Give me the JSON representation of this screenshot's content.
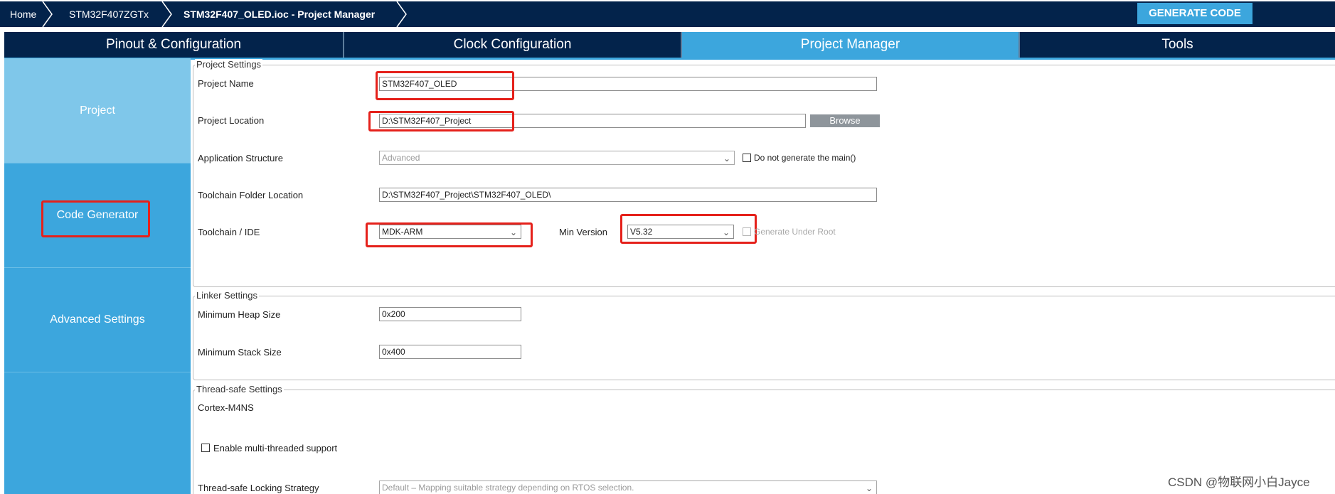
{
  "breadcrumb": {
    "home": "Home",
    "device": "STM32F407ZGTx",
    "project": "STM32F407_OLED.ioc - Project Manager"
  },
  "generate_button": "GENERATE CODE",
  "tabs": [
    {
      "label": "Pinout & Configuration",
      "active": false
    },
    {
      "label": "Clock Configuration",
      "active": false
    },
    {
      "label": "Project Manager",
      "active": true
    },
    {
      "label": "Tools",
      "active": false
    }
  ],
  "sidebar": {
    "items": [
      {
        "label": "Project",
        "active": true
      },
      {
        "label": "Code Generator",
        "active": false
      },
      {
        "label": "Advanced Settings",
        "active": false
      }
    ]
  },
  "project_settings": {
    "legend": "Project Settings",
    "project_name_label": "Project Name",
    "project_name_value": "STM32F407_OLED",
    "project_location_label": "Project Location",
    "project_location_value": "D:\\STM32F407_Project",
    "browse_label": "Browse",
    "app_structure_label": "Application Structure",
    "app_structure_value": "Advanced",
    "do_not_generate_main_label": "Do not generate the main()",
    "toolchain_folder_label": "Toolchain Folder Location",
    "toolchain_folder_value": "D:\\STM32F407_Project\\STM32F407_OLED\\",
    "toolchain_ide_label": "Toolchain / IDE",
    "toolchain_ide_value": "MDK-ARM",
    "min_version_label": "Min Version",
    "min_version_value": "V5.32",
    "generate_under_root_label": "Generate Under Root"
  },
  "linker_settings": {
    "legend": "Linker Settings",
    "heap_label": "Minimum Heap Size",
    "heap_value": "0x200",
    "stack_label": "Minimum Stack Size",
    "stack_value": "0x400"
  },
  "thread_safe_settings": {
    "legend": "Thread-safe Settings",
    "core": "Cortex-M4NS",
    "multithread_label": "Enable multi-threaded support",
    "locking_label": "Thread-safe Locking Strategy",
    "locking_value": "Default  –  Mapping suitable strategy depending on RTOS selection."
  },
  "watermark": "CSDN @物联网小白Jayce",
  "colors": {
    "navy": "#03234b",
    "accent": "#3ca6dd",
    "sidebar_active": "#7fc7ea",
    "highlight_red": "#e5211b"
  }
}
